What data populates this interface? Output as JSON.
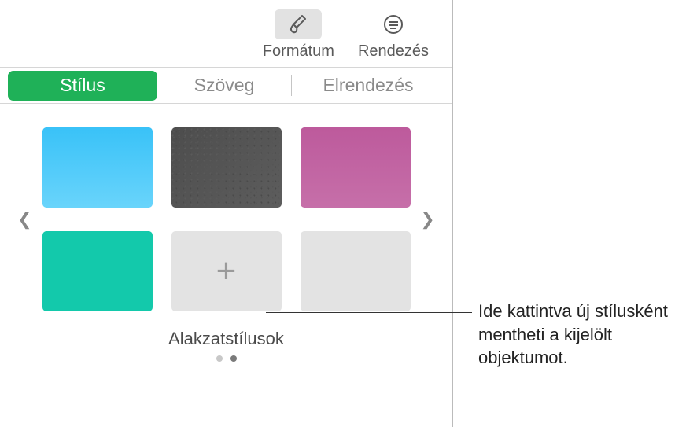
{
  "toolbar": {
    "format_label": "Formátum",
    "arrange_label": "Rendezés"
  },
  "tabs": {
    "style": "Stílus",
    "text": "Szöveg",
    "layout": "Elrendezés"
  },
  "styles": {
    "section_title": "Alakzatstílusok"
  },
  "callout": {
    "text": "Ide kattintva új stílusként mentheti a kijelölt objektumot."
  }
}
